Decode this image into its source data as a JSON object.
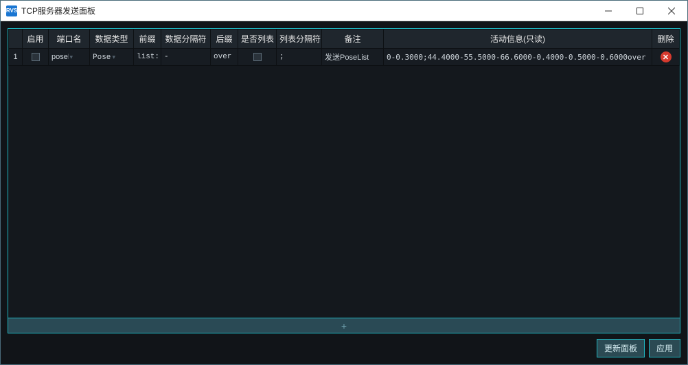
{
  "window": {
    "app_icon_text": "RVS",
    "title": "TCP服务器发送面板"
  },
  "table": {
    "headers": {
      "idx": "",
      "enable": "启用",
      "port": "端口名",
      "type": "数据类型",
      "prefix": "前缀",
      "sep": "数据分隔符",
      "suffix": "后缀",
      "is_list": "是否列表",
      "list_sep": "列表分隔符",
      "remark": "备注",
      "info": "活动信息(只读)",
      "del": "删除"
    },
    "rows": [
      {
        "idx": "1",
        "enable": false,
        "port": "poseList",
        "type": "Pose",
        "prefix": "list:",
        "sep": "-",
        "suffix": "over",
        "is_list": false,
        "list_sep": ";",
        "remark": "发送PoseList",
        "info": "0-0.3000;44.4000-55.5000-66.6000-0.4000-0.5000-0.6000over"
      }
    ]
  },
  "add_row_label": "+",
  "footer": {
    "refresh": "更新面板",
    "apply": "应用"
  }
}
